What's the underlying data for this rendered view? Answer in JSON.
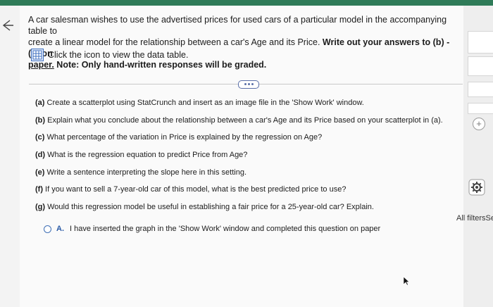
{
  "intro": {
    "line1": "A car salesman wishes to use the advertised prices for used cars of a particular model in the accompanying table to",
    "line2a": "create a linear model for the relationship between a car's Age and its Price. ",
    "line2b": "Write out your answers to (b) - (g) on",
    "line3a": "paper.",
    "line3b": " Note:  Only hand-written responses will be graded."
  },
  "table_link": {
    "label": "Click the icon to view the data table."
  },
  "questions": [
    {
      "prefix": "(a)",
      "text": " Create a scatterplot using StatCrunch and insert as an image file in the 'Show Work' window."
    },
    {
      "prefix": "(b)",
      "text": " Explain what you conclude about the relationship between a car's Age and its Price based on your scatterplot in (a)."
    },
    {
      "prefix": "(c)",
      "text": " What percentage of the variation in Price is explained by the regression on Age?"
    },
    {
      "prefix": "(d)",
      "text": " What is the regression equation to predict Price from Age?"
    },
    {
      "prefix": "(e)",
      "text": "  Write a sentence interpreting the slope here in this setting."
    },
    {
      "prefix": "(f)",
      "text": " If you want to sell a 7-year-old car of this model, what is the best predicted price to use?"
    },
    {
      "prefix": "(g)",
      "text": " Would this regression model be useful in establishing a fair price for a 25-year-old car? Explain."
    }
  ],
  "option_a": {
    "letter": "A.",
    "text": "I have inserted the graph in the 'Show Work' window and completed this question on paper"
  },
  "sidebar": {
    "filters_label": "All filtersSe",
    "plus_symbol": "+"
  },
  "colors": {
    "topbar": "#2f7b58",
    "accent": "#2a5aa6"
  }
}
